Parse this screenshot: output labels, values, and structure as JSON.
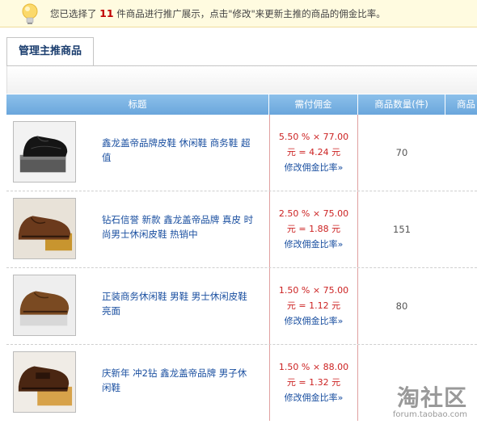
{
  "notice": {
    "prefix": "您已选择了",
    "count": "11",
    "suffix": "件商品进行推广展示，点击\"修改\"来更新主推的商品的佣金比率。"
  },
  "tabs": [
    {
      "label": "管理主推商品",
      "active": true
    }
  ],
  "table": {
    "headers": {
      "title": "标题",
      "commission": "需付佣金",
      "quantity": "商品数量(件)",
      "more": "商品"
    },
    "rows": [
      {
        "title": "鑫龙盖帝品牌皮鞋 休闲鞋 商务鞋 超值",
        "rate_line": "5.50 % × 77.00",
        "amount_line": "元 = 4.24 元",
        "edit": "修改佣金比率»",
        "qty": "70",
        "shoe": "black"
      },
      {
        "title": "钻石信誉 新款 鑫龙盖帝品牌 真皮 时尚男士休闲皮鞋 热销中",
        "rate_line": "2.50 % × 75.00",
        "amount_line": "元 = 1.88 元",
        "edit": "修改佣金比率»",
        "qty": "151",
        "shoe": "brown"
      },
      {
        "title": "正装商务休闲鞋 男鞋 男士休闲皮鞋 亮面",
        "rate_line": "1.50 % × 75.00",
        "amount_line": "元 = 1.12 元",
        "edit": "修改佣金比率»",
        "qty": "80",
        "shoe": "brown"
      },
      {
        "title": "庆新年 冲2钻 鑫龙盖帝品牌 男子休闲鞋",
        "rate_line": "1.50 % × 88.00",
        "amount_line": "元 = 1.32 元",
        "edit": "修改佣金比率»",
        "qty": "",
        "shoe": "darkbrown"
      }
    ]
  },
  "watermark": {
    "main": "淘社区",
    "sub": "forum.taobao.com"
  },
  "colors": {
    "header": "#7ab3e3",
    "notice_bg": "#fffbe0",
    "price_red": "#cc2222",
    "link_blue": "#1a4fa0"
  }
}
